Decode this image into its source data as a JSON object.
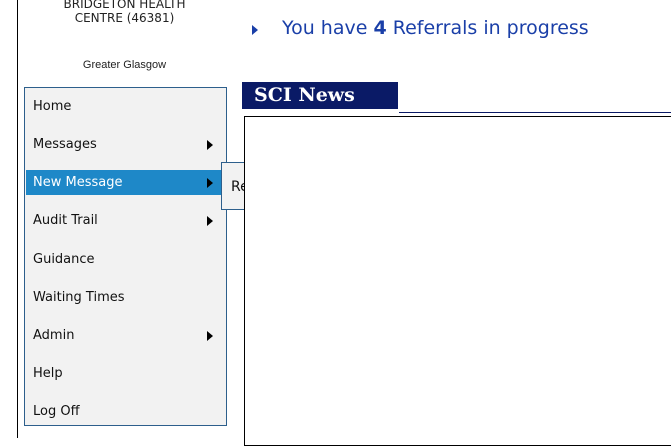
{
  "organisation": {
    "name_line1": "BRIDGETON HEALTH",
    "name_line2": "CENTRE (46381)",
    "region": "Greater Glasgow"
  },
  "menu": {
    "items": [
      {
        "label": "Home",
        "has_submenu": false,
        "active": false
      },
      {
        "label": "Messages",
        "has_submenu": true,
        "active": false
      },
      {
        "label": "New Message",
        "has_submenu": true,
        "active": true
      },
      {
        "label": "Audit Trail",
        "has_submenu": true,
        "active": false
      },
      {
        "label": "Guidance",
        "has_submenu": false,
        "active": false
      },
      {
        "label": "Waiting Times",
        "has_submenu": false,
        "active": false
      },
      {
        "label": "Admin",
        "has_submenu": true,
        "active": false
      },
      {
        "label": "Help",
        "has_submenu": false,
        "active": false
      },
      {
        "label": "Log Off",
        "has_submenu": false,
        "active": false
      }
    ]
  },
  "submenu": {
    "items": [
      {
        "label": "Referral"
      }
    ]
  },
  "status": {
    "prefix": "You have",
    "count": "4",
    "suffix": "Referrals in progress"
  },
  "news": {
    "title": "SCI News"
  },
  "colors": {
    "menu_active_bg": "#1e88c8",
    "news_header_bg": "#0a1a66",
    "status_text": "#1a3fa8"
  }
}
